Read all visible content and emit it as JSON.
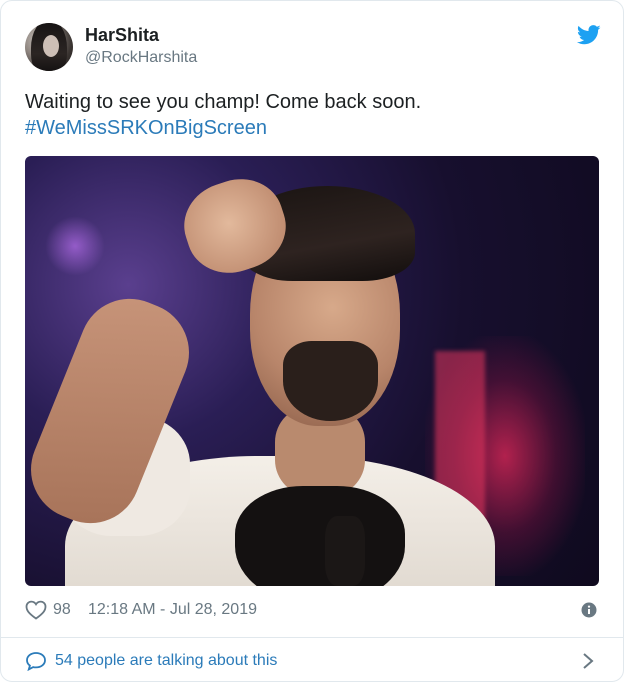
{
  "author": {
    "name": "HarShita",
    "handle": "@RockHarshita"
  },
  "tweet": {
    "text": "Waiting to see you champ! Come back soon.",
    "hashtag": "#WeMissSRKOnBigScreen"
  },
  "stats": {
    "likes": "98",
    "timestamp": "12:18 AM - Jul 28, 2019"
  },
  "footer": {
    "talking": "54 people are talking about this"
  },
  "colors": {
    "twitter_blue": "#1da1f2",
    "link": "#2b7bb9",
    "muted": "#697882"
  },
  "icons": {
    "brand": "twitter-bird-icon",
    "like": "heart-icon",
    "info": "info-icon",
    "conversation": "speech-bubble-icon",
    "more": "chevron-right-icon"
  }
}
